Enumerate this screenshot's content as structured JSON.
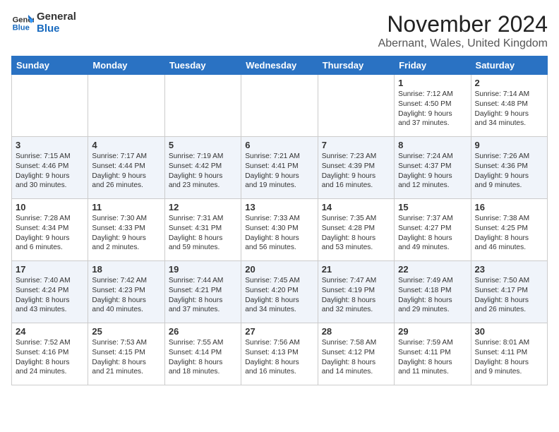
{
  "logo": {
    "line1": "General",
    "line2": "Blue"
  },
  "title": "November 2024",
  "location": "Abernant, Wales, United Kingdom",
  "days_of_week": [
    "Sunday",
    "Monday",
    "Tuesday",
    "Wednesday",
    "Thursday",
    "Friday",
    "Saturday"
  ],
  "weeks": [
    [
      {
        "day": "",
        "info": ""
      },
      {
        "day": "",
        "info": ""
      },
      {
        "day": "",
        "info": ""
      },
      {
        "day": "",
        "info": ""
      },
      {
        "day": "",
        "info": ""
      },
      {
        "day": "1",
        "info": "Sunrise: 7:12 AM\nSunset: 4:50 PM\nDaylight: 9 hours\nand 37 minutes."
      },
      {
        "day": "2",
        "info": "Sunrise: 7:14 AM\nSunset: 4:48 PM\nDaylight: 9 hours\nand 34 minutes."
      }
    ],
    [
      {
        "day": "3",
        "info": "Sunrise: 7:15 AM\nSunset: 4:46 PM\nDaylight: 9 hours\nand 30 minutes."
      },
      {
        "day": "4",
        "info": "Sunrise: 7:17 AM\nSunset: 4:44 PM\nDaylight: 9 hours\nand 26 minutes."
      },
      {
        "day": "5",
        "info": "Sunrise: 7:19 AM\nSunset: 4:42 PM\nDaylight: 9 hours\nand 23 minutes."
      },
      {
        "day": "6",
        "info": "Sunrise: 7:21 AM\nSunset: 4:41 PM\nDaylight: 9 hours\nand 19 minutes."
      },
      {
        "day": "7",
        "info": "Sunrise: 7:23 AM\nSunset: 4:39 PM\nDaylight: 9 hours\nand 16 minutes."
      },
      {
        "day": "8",
        "info": "Sunrise: 7:24 AM\nSunset: 4:37 PM\nDaylight: 9 hours\nand 12 minutes."
      },
      {
        "day": "9",
        "info": "Sunrise: 7:26 AM\nSunset: 4:36 PM\nDaylight: 9 hours\nand 9 minutes."
      }
    ],
    [
      {
        "day": "10",
        "info": "Sunrise: 7:28 AM\nSunset: 4:34 PM\nDaylight: 9 hours\nand 6 minutes."
      },
      {
        "day": "11",
        "info": "Sunrise: 7:30 AM\nSunset: 4:33 PM\nDaylight: 9 hours\nand 2 minutes."
      },
      {
        "day": "12",
        "info": "Sunrise: 7:31 AM\nSunset: 4:31 PM\nDaylight: 8 hours\nand 59 minutes."
      },
      {
        "day": "13",
        "info": "Sunrise: 7:33 AM\nSunset: 4:30 PM\nDaylight: 8 hours\nand 56 minutes."
      },
      {
        "day": "14",
        "info": "Sunrise: 7:35 AM\nSunset: 4:28 PM\nDaylight: 8 hours\nand 53 minutes."
      },
      {
        "day": "15",
        "info": "Sunrise: 7:37 AM\nSunset: 4:27 PM\nDaylight: 8 hours\nand 49 minutes."
      },
      {
        "day": "16",
        "info": "Sunrise: 7:38 AM\nSunset: 4:25 PM\nDaylight: 8 hours\nand 46 minutes."
      }
    ],
    [
      {
        "day": "17",
        "info": "Sunrise: 7:40 AM\nSunset: 4:24 PM\nDaylight: 8 hours\nand 43 minutes."
      },
      {
        "day": "18",
        "info": "Sunrise: 7:42 AM\nSunset: 4:23 PM\nDaylight: 8 hours\nand 40 minutes."
      },
      {
        "day": "19",
        "info": "Sunrise: 7:44 AM\nSunset: 4:21 PM\nDaylight: 8 hours\nand 37 minutes."
      },
      {
        "day": "20",
        "info": "Sunrise: 7:45 AM\nSunset: 4:20 PM\nDaylight: 8 hours\nand 34 minutes."
      },
      {
        "day": "21",
        "info": "Sunrise: 7:47 AM\nSunset: 4:19 PM\nDaylight: 8 hours\nand 32 minutes."
      },
      {
        "day": "22",
        "info": "Sunrise: 7:49 AM\nSunset: 4:18 PM\nDaylight: 8 hours\nand 29 minutes."
      },
      {
        "day": "23",
        "info": "Sunrise: 7:50 AM\nSunset: 4:17 PM\nDaylight: 8 hours\nand 26 minutes."
      }
    ],
    [
      {
        "day": "24",
        "info": "Sunrise: 7:52 AM\nSunset: 4:16 PM\nDaylight: 8 hours\nand 24 minutes."
      },
      {
        "day": "25",
        "info": "Sunrise: 7:53 AM\nSunset: 4:15 PM\nDaylight: 8 hours\nand 21 minutes."
      },
      {
        "day": "26",
        "info": "Sunrise: 7:55 AM\nSunset: 4:14 PM\nDaylight: 8 hours\nand 18 minutes."
      },
      {
        "day": "27",
        "info": "Sunrise: 7:56 AM\nSunset: 4:13 PM\nDaylight: 8 hours\nand 16 minutes."
      },
      {
        "day": "28",
        "info": "Sunrise: 7:58 AM\nSunset: 4:12 PM\nDaylight: 8 hours\nand 14 minutes."
      },
      {
        "day": "29",
        "info": "Sunrise: 7:59 AM\nSunset: 4:11 PM\nDaylight: 8 hours\nand 11 minutes."
      },
      {
        "day": "30",
        "info": "Sunrise: 8:01 AM\nSunset: 4:11 PM\nDaylight: 8 hours\nand 9 minutes."
      }
    ]
  ]
}
